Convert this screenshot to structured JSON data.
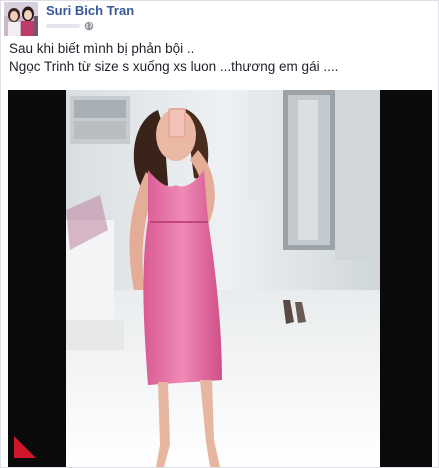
{
  "post": {
    "author_name": "Suri Bich Tran",
    "privacy_icon": "globe-icon",
    "text_lines": [
      "Sau khi biết mình bị phản bội ..",
      "Ngọc Trinh từ size s xuống xs luon ...thương em gái ...."
    ],
    "media_type": "video",
    "icons": {
      "avatar": "avatar-photo",
      "corner_marker": "red-triangle-icon"
    }
  },
  "colors": {
    "author_link": "#365899",
    "body_text": "#1d2129",
    "border": "#dddfe2",
    "video_background": "#0a0a0a",
    "dress": "#e86fa3",
    "marker": "#d0162a"
  }
}
